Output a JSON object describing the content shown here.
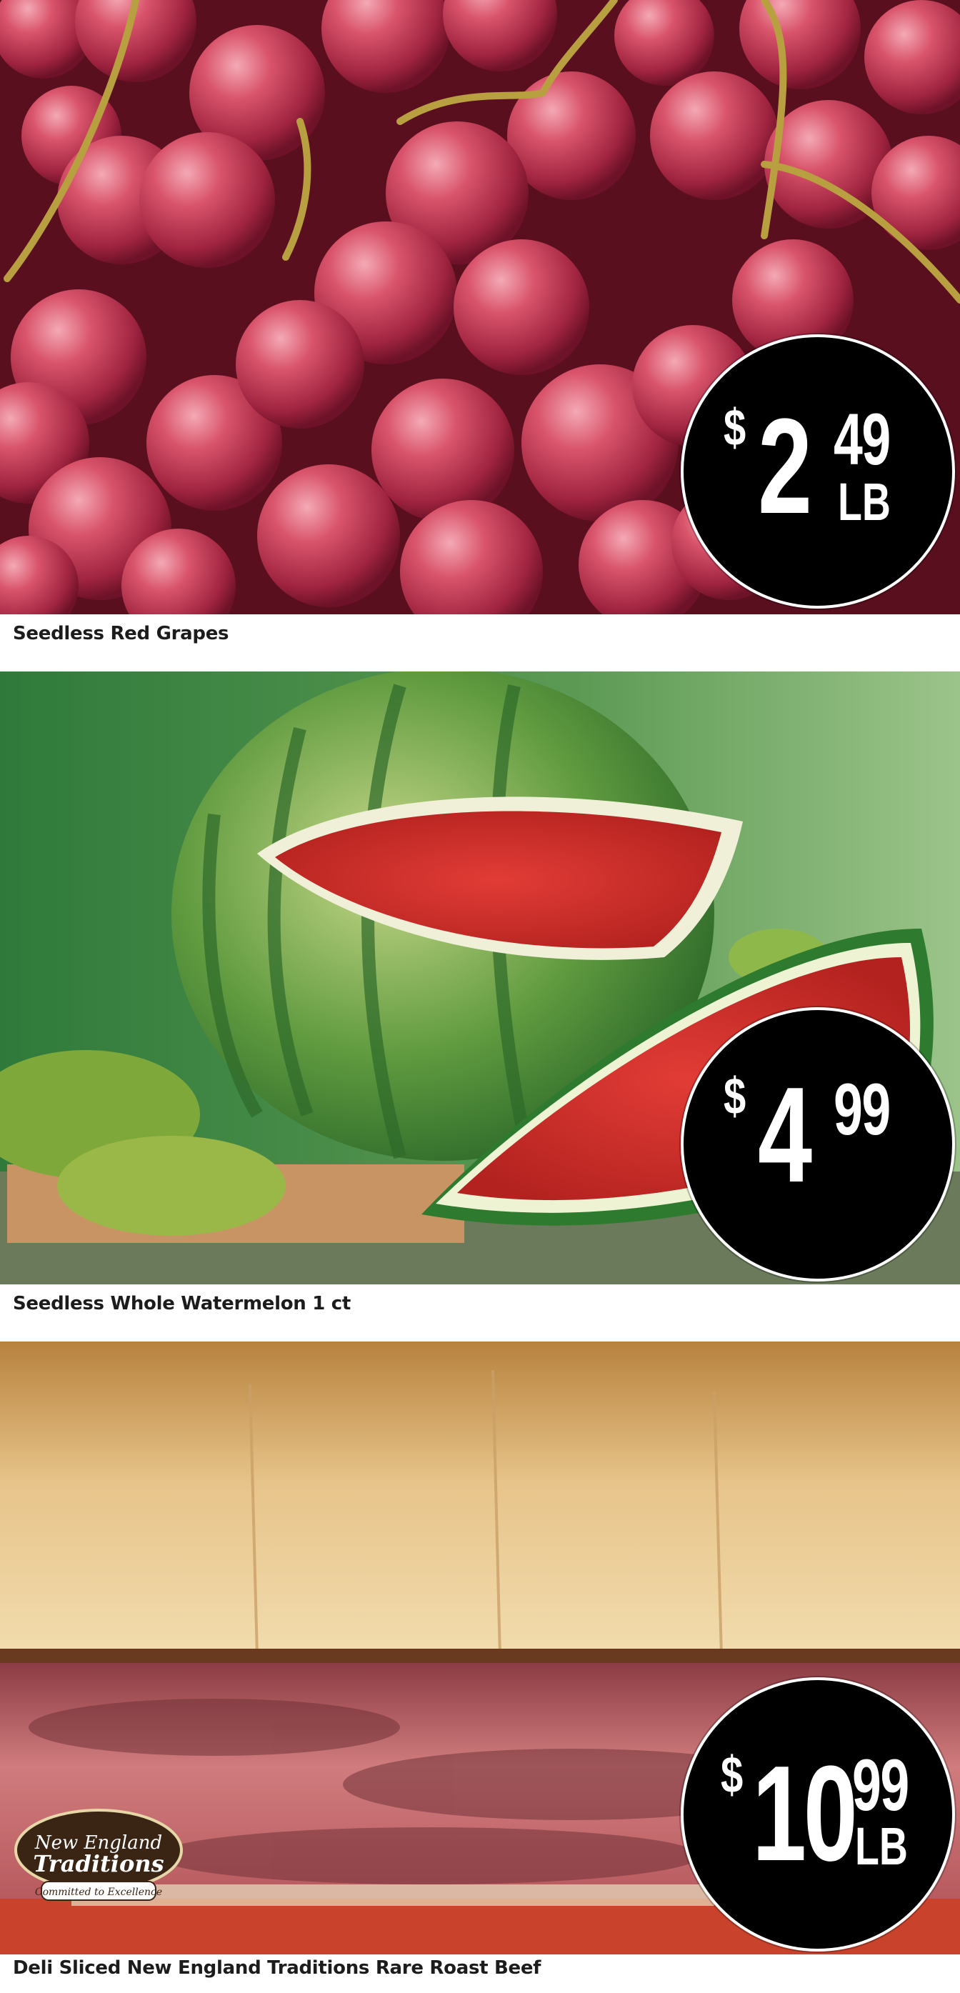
{
  "products": [
    {
      "name": "Seedless Red Grapes",
      "image": "red-grapes-photo",
      "price": {
        "dollar_sign": "$",
        "whole": "2",
        "cents": "49",
        "unit": "LB"
      }
    },
    {
      "name": "Seedless Whole Watermelon 1 ct",
      "image": "watermelon-photo",
      "price": {
        "dollar_sign": "$",
        "whole": "4",
        "cents": "99",
        "unit": ""
      }
    },
    {
      "name": "Deli Sliced New England Traditions Rare Roast Beef",
      "image": "roast-beef-sandwich-photo",
      "price": {
        "dollar_sign": "$",
        "whole": "10",
        "cents": "99",
        "unit": "LB"
      },
      "brand_logo": {
        "line1": "New England",
        "line2": "Traditions",
        "tagline": "Committed to Excellence"
      }
    }
  ],
  "colors": {
    "badge_bg": "#000000",
    "badge_text": "#ffffff",
    "caption_text": "#1c1c1c",
    "grape": "#c23b55",
    "watermelon_flesh": "#d8322e",
    "watermelon_rind": "#3f8a3a",
    "bread": "#e2b978",
    "beef": "#c46d6f"
  }
}
